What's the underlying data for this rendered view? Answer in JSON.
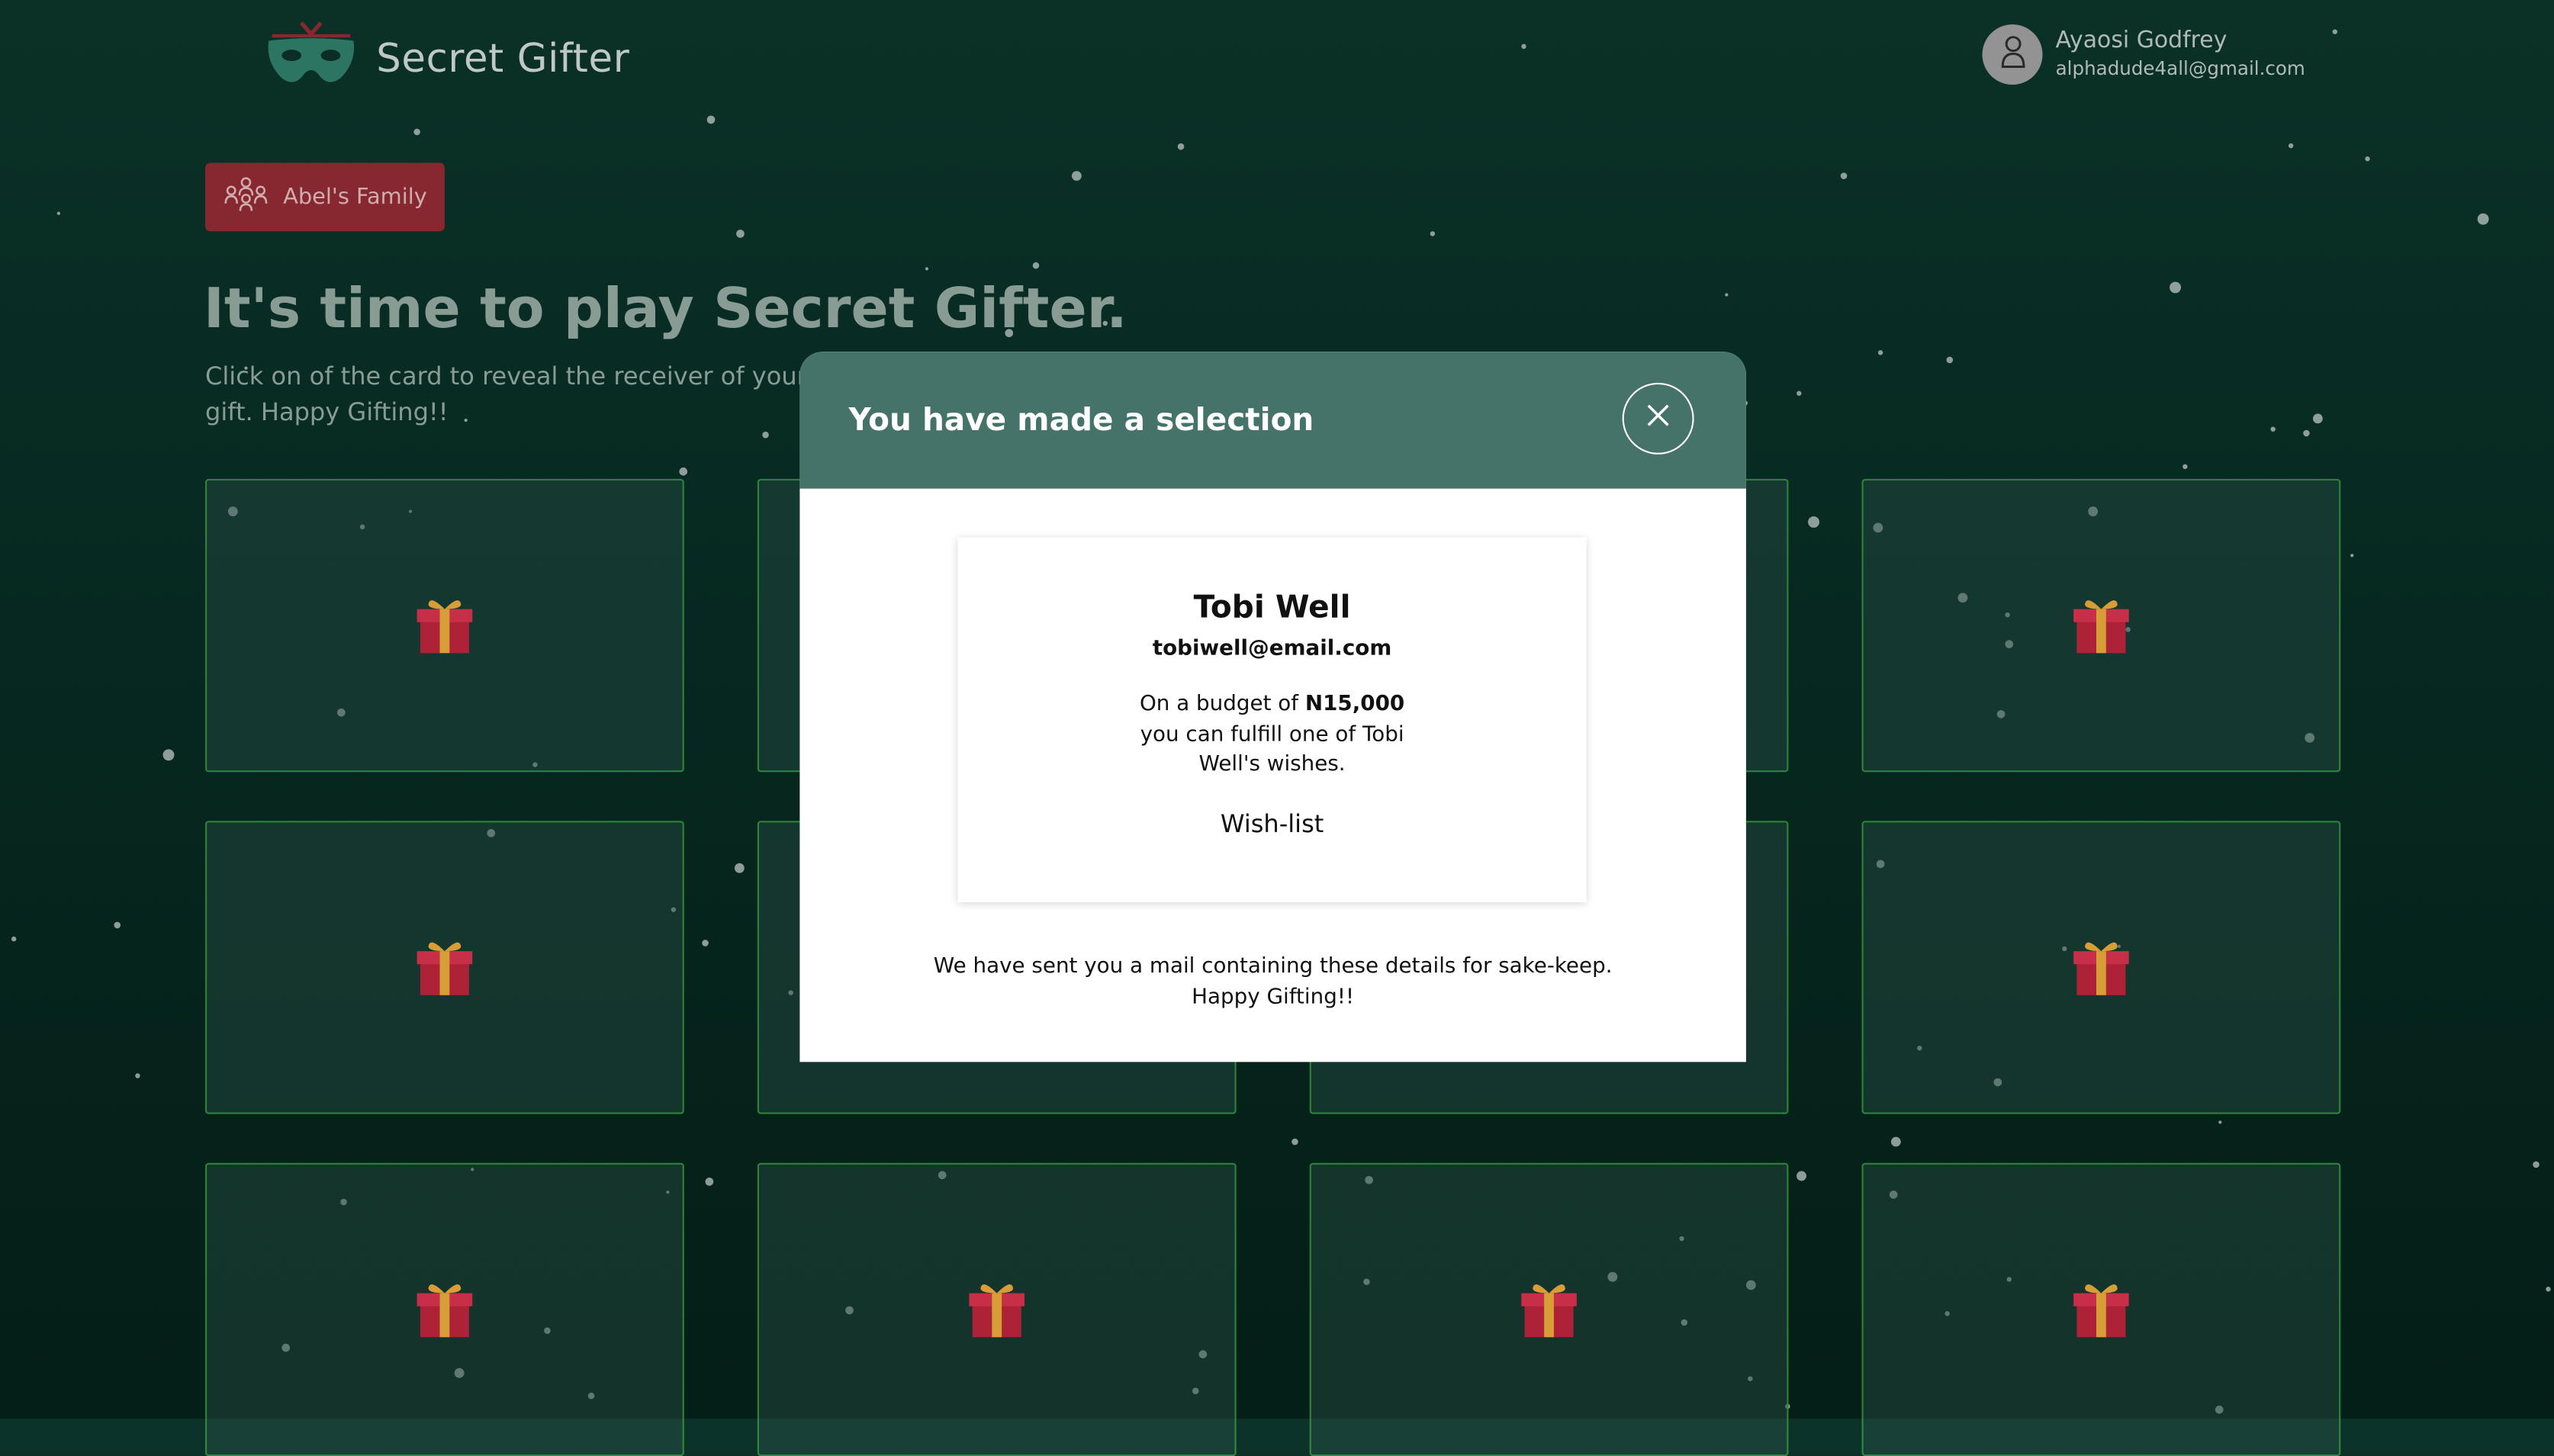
{
  "app": {
    "brand_name": "Secret Gifter",
    "colors": {
      "background": "#072a22",
      "accent_red": "#8d2a32",
      "card_border": "#2f8a3c",
      "modal_header": "#467369"
    }
  },
  "user": {
    "name": "Ayaosi Godfrey",
    "email": "alphadude4all@gmail.com",
    "avatar_icon": "user-icon"
  },
  "group_button": {
    "label": "Abel's Family",
    "icon": "group-icon"
  },
  "main": {
    "heading": "It's time to play Secret Gifter.",
    "subtitle": "Click on of the card to reveal the receiver of your gift. Happy Gifting!!"
  },
  "cards": {
    "count": 12,
    "icon": "gift-icon"
  },
  "modal": {
    "title": "You have made a selection",
    "close_icon": "close-icon",
    "receiver": {
      "name": "Tobi Well",
      "email": "tobiwell@email.com",
      "budget_prefix": "On a budget of ",
      "budget_amount": "N15,000",
      "budget_suffix": " you can fulfill one of Tobi Well's wishes.",
      "wishlist_label": "Wish-list"
    },
    "note_line1": "We have sent you a mail containing these details for sake-keep.",
    "note_line2": "Happy Gifting!!"
  }
}
